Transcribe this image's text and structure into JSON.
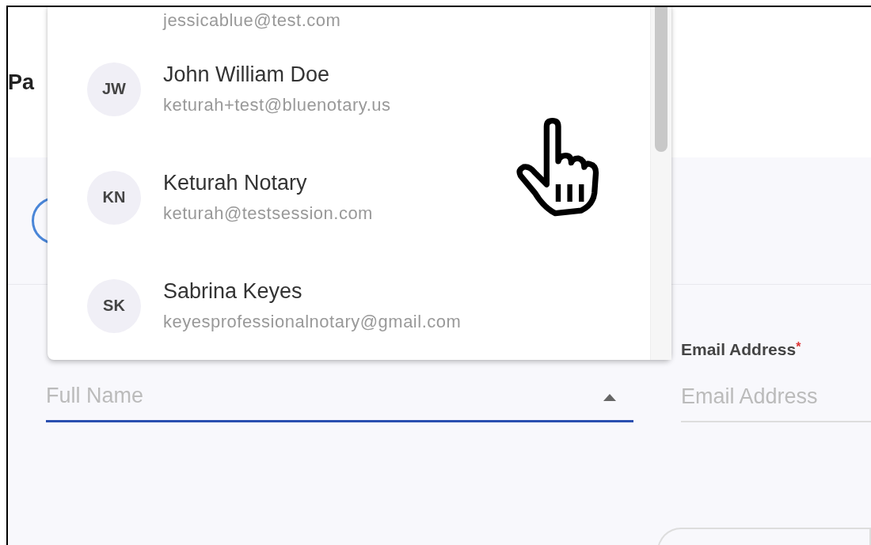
{
  "heading": "Pa",
  "dropdown": {
    "items": [
      {
        "email": "jessicablue@test.com"
      },
      {
        "initials": "JW",
        "name": "John William Doe",
        "email": "keturah+test@bluenotary.us"
      },
      {
        "initials": "KN",
        "name": "Keturah Notary",
        "email": "keturah@testsession.com"
      },
      {
        "initials": "SK",
        "name": "Sabrina Keyes",
        "email": "keyesprofessionalnotary@gmail.com"
      }
    ]
  },
  "full_name_field": {
    "placeholder": "Full Name",
    "focused": true,
    "expanded": true
  },
  "email_field": {
    "label": "Email Address",
    "required_mark": "*",
    "placeholder": "Email Address",
    "focused": false
  }
}
